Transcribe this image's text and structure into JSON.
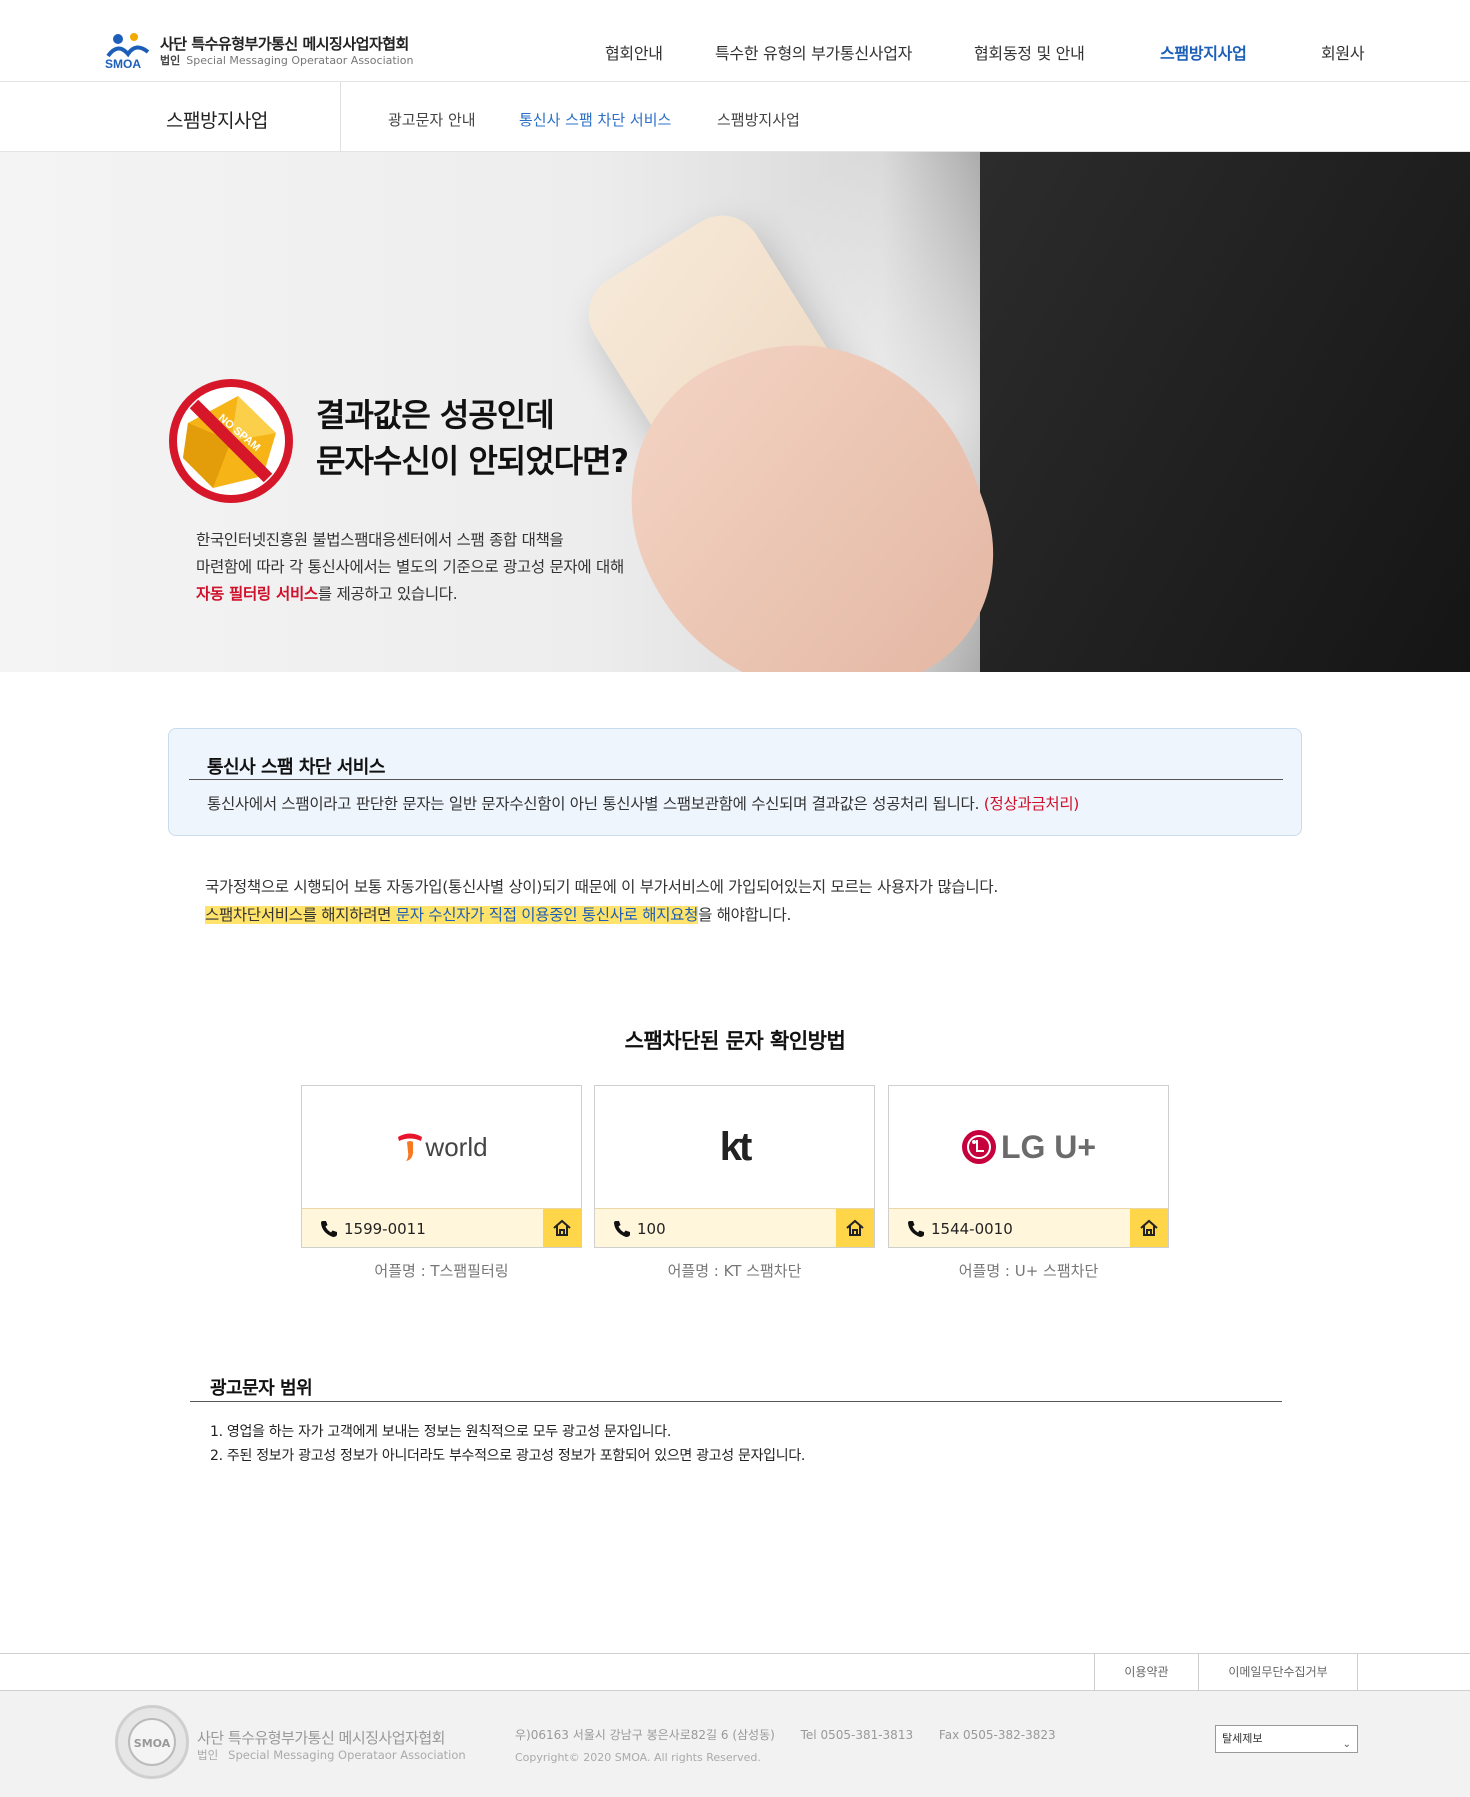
{
  "header": {
    "logo_line1": "사단 특수유형부가통신 메시징사업자협회",
    "logo_prefix": "법인",
    "logo_line2": "Special Messaging Operataor Association",
    "logo_mark_text": "SMOA",
    "nav": [
      "협회안내",
      "특수한 유형의 부가통신사업자",
      "협회동정 및 안내",
      "스팸방지사업",
      "회원사"
    ]
  },
  "subnav": {
    "title": "스팸방지사업",
    "links": [
      "광고문자 안내",
      "통신사 스팸 차단 서비스",
      "스팸방지사업"
    ]
  },
  "hero": {
    "badge_text": "NO SPAM",
    "title_line1": "결과값은 성공인데",
    "title_line2": "문자수신이 안되었다면?",
    "desc_line1": "한국인터넷진흥원 불법스팸대응센터에서 스팸 종합 대책을",
    "desc_line2": "마련함에 따라 각 통신사에서는 별도의 기준으로 광고성 문자에 대해",
    "desc_highlight": "자동 필터링 서비스",
    "desc_tail": "를 제공하고 있습니다."
  },
  "infobox": {
    "title": "통신사 스팸 차단 서비스",
    "text": "통신사에서 스팸이라고 판단한 문자는 일반 문자수신함이 아닌 통신사별 스팸보관함에 수신되며 결과값은 성공처리 됩니다.",
    "text_red": "(정상과금처리)"
  },
  "policy": {
    "line1": "국가정책으로 시행되어 보통 자동가입(통신사별 상이)되기 때문에 이 부가서비스에 가입되어있는지 모르는 사용자가 많습니다.",
    "line2_hl": "스팸차단서비스를 해지하려면 ",
    "line2_hl_blue": "문자 수신자가 직접 이용중인 통신사로 해지요청",
    "line2_tail": "을 해야합니다."
  },
  "check": {
    "title": "스팸차단된 문자 확인방법",
    "cards": [
      {
        "logo": "world",
        "number": "1599-0011",
        "app": "어플명 : T스팸필터링"
      },
      {
        "logo": "kt",
        "number": "100",
        "app": "어플명 : KT 스팸차단"
      },
      {
        "logo": "LG U+",
        "number": "1544-0010",
        "app": "어플명 : U+ 스팸차단"
      }
    ]
  },
  "scope": {
    "title": "광고문자 범위",
    "items": [
      "1. 영업을 하는 자가 고객에게 보내는 정보는 원칙적으로 모두 광고성 문자입니다.",
      "2. 주된 정보가 광고성 정보가 아니더라도 부수적으로 광고성 정보가 포함되어 있으면 광고성 문자입니다."
    ]
  },
  "footer": {
    "links": [
      "이용약관",
      "이메일무단수집거부"
    ],
    "org_line1": "사단 특수유형부가통신 메시징사업자협회",
    "org_prefix": "법인",
    "org_line2": "Special Messaging Operataor Association",
    "address": "우)06163 서울시 강남구 봉은사로82길 6 (삼성동)",
    "tel": "Tel 0505-381-3813",
    "fax": "Fax 0505-382-3823",
    "copyright": "Copyright© 2020 SMOA. All rights Reserved.",
    "select_value": "탈세제보"
  },
  "colors": {
    "accent": "#1d5fb8",
    "red": "#d0102a",
    "highlight": "#ffe36a",
    "card_bar": "#fff6dc"
  }
}
